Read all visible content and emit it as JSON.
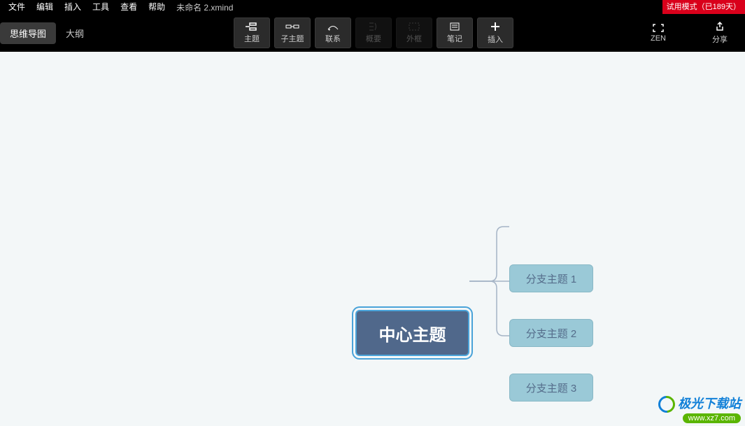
{
  "menu": {
    "items": [
      "文件",
      "编辑",
      "插入",
      "工具",
      "查看",
      "帮助"
    ],
    "filename": "未命名 2.xmind",
    "trial": "试用模式（已189天）"
  },
  "viewTabs": {
    "mindmap": "思维导图",
    "outline": "大纲"
  },
  "tools": {
    "topic": "主题",
    "subtopic": "子主题",
    "relation": "联系",
    "summary": "概要",
    "boundary": "外框",
    "note": "笔记",
    "insert": "插入",
    "zen": "ZEN",
    "share": "分享"
  },
  "map": {
    "central": "中心主题",
    "branches": [
      "分支主题 1",
      "分支主题 2",
      "分支主题 3"
    ]
  },
  "watermark": {
    "site": "极光下载站",
    "url": "www.xz7.com"
  }
}
